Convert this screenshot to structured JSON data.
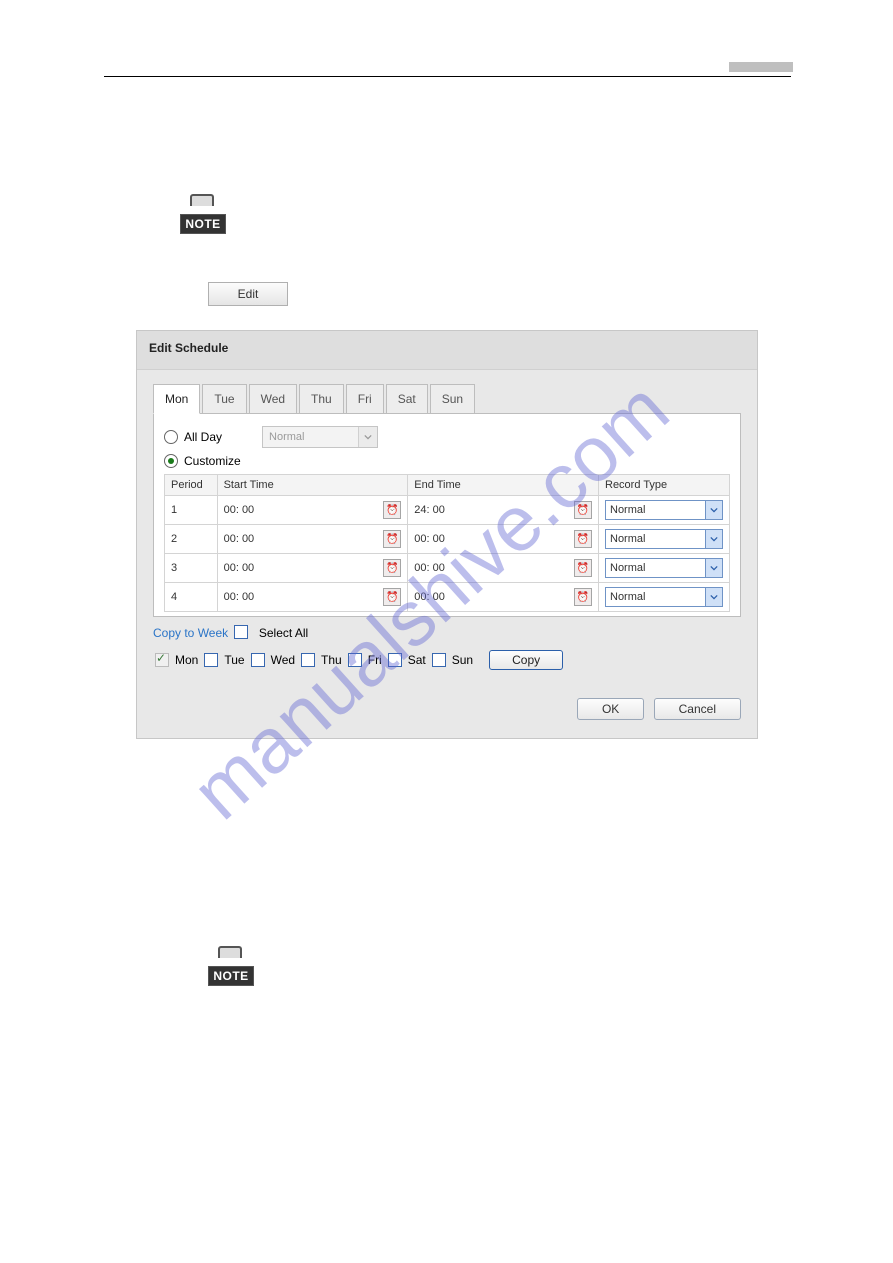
{
  "note_label": "NOTE",
  "edit_button_label": "Edit",
  "watermark": "manualshive.com",
  "dialog": {
    "title": "Edit Schedule",
    "tabs": [
      "Mon",
      "Tue",
      "Wed",
      "Thu",
      "Fri",
      "Sat",
      "Sun"
    ],
    "active_tab": "Mon",
    "all_day_label": "All Day",
    "customize_label": "Customize",
    "type_dropdown_disabled_value": "Normal",
    "table": {
      "headers": [
        "Period",
        "Start Time",
        "End Time",
        "Record Type"
      ],
      "rows": [
        {
          "period": "1",
          "start": "00: 00",
          "end": "24: 00",
          "type": "Normal"
        },
        {
          "period": "2",
          "start": "00: 00",
          "end": "00: 00",
          "type": "Normal"
        },
        {
          "period": "3",
          "start": "00: 00",
          "end": "00: 00",
          "type": "Normal"
        },
        {
          "period": "4",
          "start": "00: 00",
          "end": "00: 00",
          "type": "Normal"
        }
      ]
    },
    "copy_to_week_label": "Copy to Week",
    "select_all_label": "Select All",
    "days": [
      "Mon",
      "Tue",
      "Wed",
      "Thu",
      "Fri",
      "Sat",
      "Sun"
    ],
    "copy_label": "Copy",
    "ok_label": "OK",
    "cancel_label": "Cancel"
  }
}
